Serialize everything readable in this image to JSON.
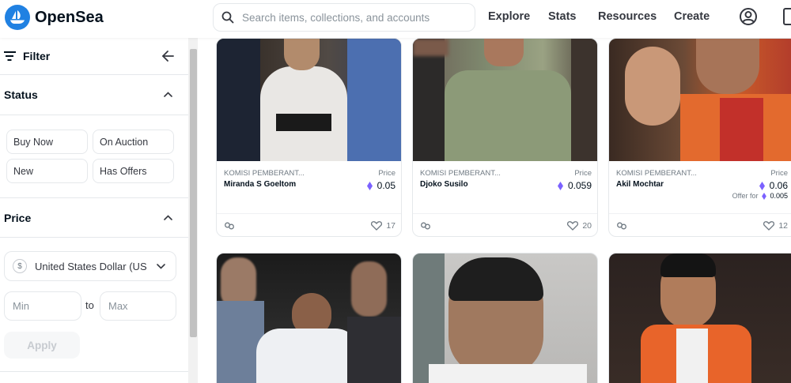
{
  "header": {
    "brand": "OpenSea",
    "search_placeholder": "Search items, collections, and accounts",
    "nav": [
      "Explore",
      "Stats",
      "Resources",
      "Create"
    ]
  },
  "sidebar": {
    "filter_label": "Filter",
    "status": {
      "title": "Status",
      "options": [
        "Buy Now",
        "On Auction",
        "New",
        "Has Offers"
      ]
    },
    "price": {
      "title": "Price",
      "currency": "United States Dollar (USD)",
      "currency_symbol": "$",
      "min_placeholder": "Min",
      "to_label": "to",
      "max_placeholder": "Max",
      "apply_label": "Apply"
    }
  },
  "cards": [
    {
      "collection": "KOMISI PEMBERANT...",
      "name": "Miranda S Goeltom",
      "price_label": "Price",
      "price": "0.05",
      "likes": "17"
    },
    {
      "collection": "KOMISI PEMBERANT...",
      "name": "Djoko Susilo",
      "price_label": "Price",
      "price": "0.059",
      "likes": "20"
    },
    {
      "collection": "KOMISI PEMBERANT...",
      "name": "Akil Mochtar",
      "price_label": "Price",
      "price": "0.06",
      "offer_label": "Offer for",
      "offer_value": "0.005",
      "likes": "12"
    }
  ],
  "colors": {
    "brand_blue": "#2081e2",
    "eth_purple": "#7b61ff"
  }
}
